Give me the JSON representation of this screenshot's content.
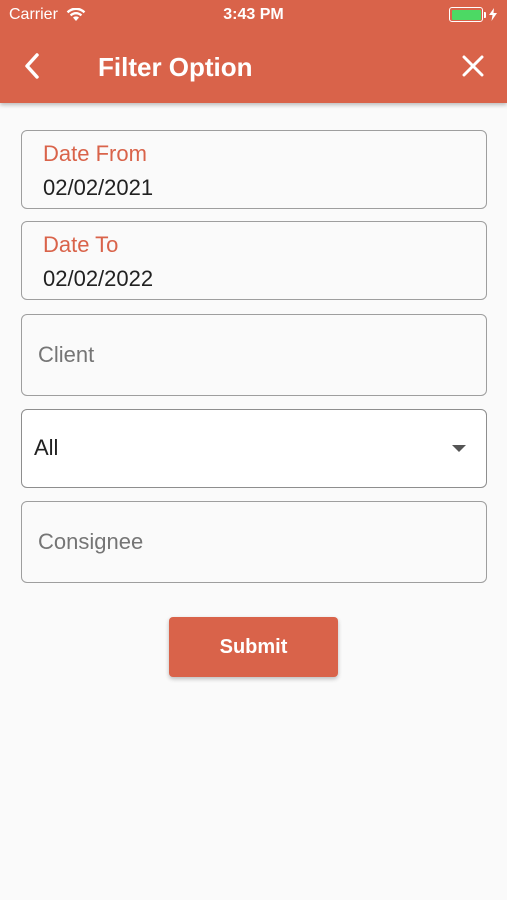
{
  "status_bar": {
    "carrier": "Carrier",
    "time": "3:43 PM",
    "battery_color": "#4cd964"
  },
  "header": {
    "title": "Filter Option",
    "back_icon": "chevron-left-icon",
    "close_icon": "close-icon",
    "background_color": "#d9634a"
  },
  "form": {
    "date_from": {
      "label": "Date From",
      "value": "02/02/2021"
    },
    "date_to": {
      "label": "Date To",
      "value": "02/02/2022"
    },
    "client": {
      "placeholder": "Client",
      "value": ""
    },
    "status_select": {
      "selected": "All",
      "icon": "dropdown-arrow-icon"
    },
    "consignee": {
      "placeholder": "Consignee",
      "value": ""
    },
    "submit_label": "Submit"
  }
}
